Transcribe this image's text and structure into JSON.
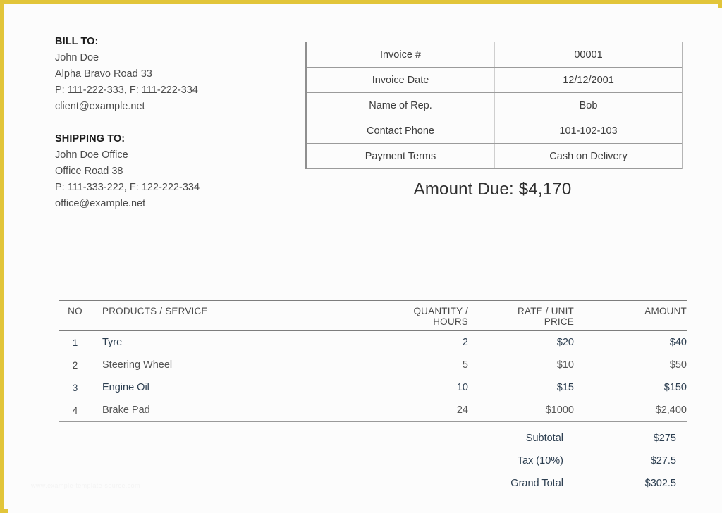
{
  "frame": {
    "border_color": "#e2c53a",
    "background": "#fcfcfc"
  },
  "watermark": {
    "text": "www.example-template-source.com"
  },
  "bill_to": {
    "heading": "BILL TO:",
    "lines": [
      "John Doe",
      "Alpha Bravo Road 33",
      "P: 111-222-333, F: 111-222-334",
      "client@example.net"
    ]
  },
  "shipping_to": {
    "heading": "SHIPPING TO:",
    "lines": [
      "John Doe Office",
      "Office Road 38",
      "P: 111-333-222, F: 122-222-334",
      "office@example.net"
    ]
  },
  "details": {
    "rows": [
      {
        "label": "Invoice #",
        "value": "00001"
      },
      {
        "label": "Invoice Date",
        "value": "12/12/2001"
      },
      {
        "label": "Name of Rep.",
        "value": "Bob"
      },
      {
        "label": "Contact Phone",
        "value": "101-102-103"
      },
      {
        "label": "Payment Terms",
        "value": "Cash on Delivery"
      }
    ]
  },
  "amount_due": {
    "text": "Amount Due: $4,170"
  },
  "items": {
    "headers": {
      "no": "NO",
      "description": "PRODUCTS / SERVICE",
      "quantity_line1": "QUANTITY /",
      "quantity_line2": "HOURS",
      "rate_line1": "RATE / UNIT",
      "rate_line2": "PRICE",
      "amount": "AMOUNT"
    },
    "rows": [
      {
        "no": "1",
        "description": "Tyre",
        "quantity": "2",
        "rate": "$20",
        "amount": "$40",
        "highlight": true
      },
      {
        "no": "2",
        "description": "Steering Wheel",
        "quantity": "5",
        "rate": "$10",
        "amount": "$50",
        "highlight": false
      },
      {
        "no": "3",
        "description": "Engine Oil",
        "quantity": "10",
        "rate": "$15",
        "amount": "$150",
        "highlight": true
      },
      {
        "no": "4",
        "description": "Brake Pad",
        "quantity": "24",
        "rate": "$1000",
        "amount": "$2,400",
        "highlight": false
      }
    ]
  },
  "totals": {
    "rows": [
      {
        "label": "Subtotal",
        "value": "$275"
      },
      {
        "label": "Tax (10%)",
        "value": "$27.5"
      },
      {
        "label": "Grand Total",
        "value": "$302.5"
      }
    ]
  }
}
